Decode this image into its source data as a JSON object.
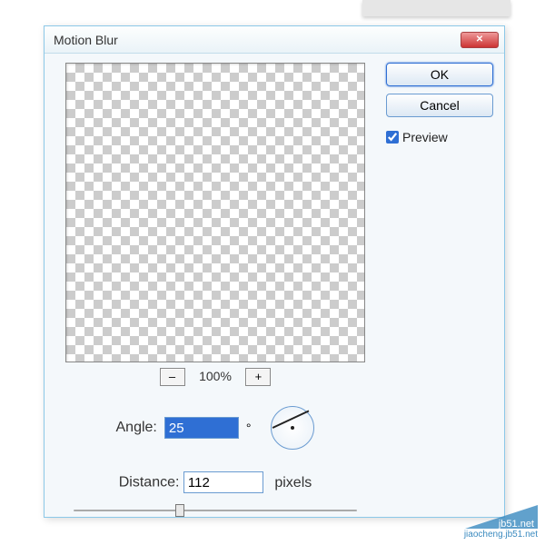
{
  "dialog": {
    "title": "Motion Blur",
    "close_glyph": "✕"
  },
  "buttons": {
    "ok": "OK",
    "cancel": "Cancel"
  },
  "preview": {
    "checkbox_label": "Preview",
    "checked": true
  },
  "zoom": {
    "minus": "–",
    "percent": "100%",
    "plus": "+"
  },
  "angle": {
    "label": "Angle:",
    "value": "25",
    "degree": "°"
  },
  "distance": {
    "label": "Distance:",
    "value": "112",
    "unit": "pixels"
  },
  "watermark": {
    "line1": "jb51.net",
    "line2": "jiaocheng.jb51.net"
  }
}
